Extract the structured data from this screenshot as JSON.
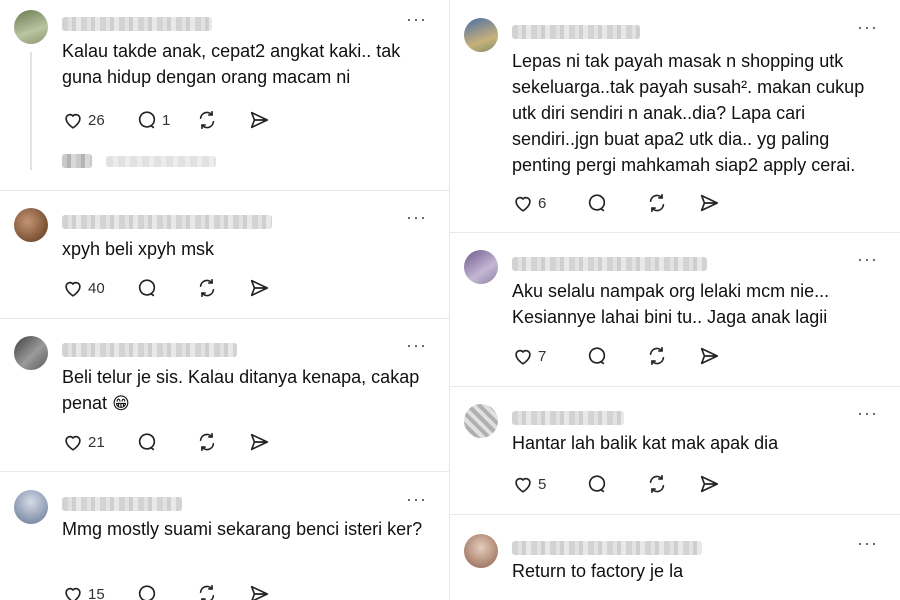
{
  "more_glyph": "···",
  "icons": {
    "like": "heart-icon",
    "reply": "comment-bubble-icon",
    "repost": "repost-icon",
    "share": "send-icon",
    "more": "more-options-icon"
  },
  "left_column": {
    "posts": [
      {
        "text": "Kalau takde anak, cepat2 angkat kaki.. tak guna hidup dengan orang macam ni",
        "likes": "26",
        "replies": "1",
        "avatar_colors": [
          "#6b7a52",
          "#b9c4a0"
        ]
      },
      {
        "text": "xpyh beli xpyh msk",
        "likes": "40",
        "replies": "",
        "avatar_colors": [
          "#7a5234",
          "#c49474"
        ]
      },
      {
        "text": "Beli telur je sis. Kalau ditanya kenapa, cakap penat",
        "emoji": "😁",
        "likes": "21",
        "replies": "",
        "avatar_colors": [
          "#3f3f3f",
          "#9a9a9a"
        ]
      },
      {
        "text": "Mmg mostly suami sekarang benci isteri ker?",
        "likes": "15",
        "replies": "",
        "avatar_colors": [
          "#8090a8",
          "#d5dbe6"
        ]
      }
    ]
  },
  "right_column": {
    "posts": [
      {
        "text": "Lepas ni tak payah masak n shopping utk sekeluarga..tak payah susah². makan cukup utk diri sendiri n anak..dia? Lapa cari sendiri..jgn buat apa2 utk dia.. yg paling penting pergi mahkamah siap2 apply cerai.",
        "likes": "6",
        "replies": "",
        "avatar_colors": [
          "#4a6fa5",
          "#c9b07a"
        ]
      },
      {
        "text": "Aku selalu nampak org lelaki mcm nie... Kesiannye lahai bini tu.. Jaga anak lagii",
        "likes": "7",
        "replies": "",
        "avatar_colors": [
          "#6d5a8a",
          "#c4b7d4"
        ]
      },
      {
        "text": "Hantar lah balik kat mak apak dia",
        "likes": "5",
        "replies": "",
        "avatar_colors": [
          "#b0b0b0",
          "#e0e0e0"
        ]
      },
      {
        "text": "Return to factory je la",
        "likes": "",
        "replies": "",
        "avatar_colors": [
          "#a37b66",
          "#e6cdbd"
        ]
      }
    ]
  }
}
